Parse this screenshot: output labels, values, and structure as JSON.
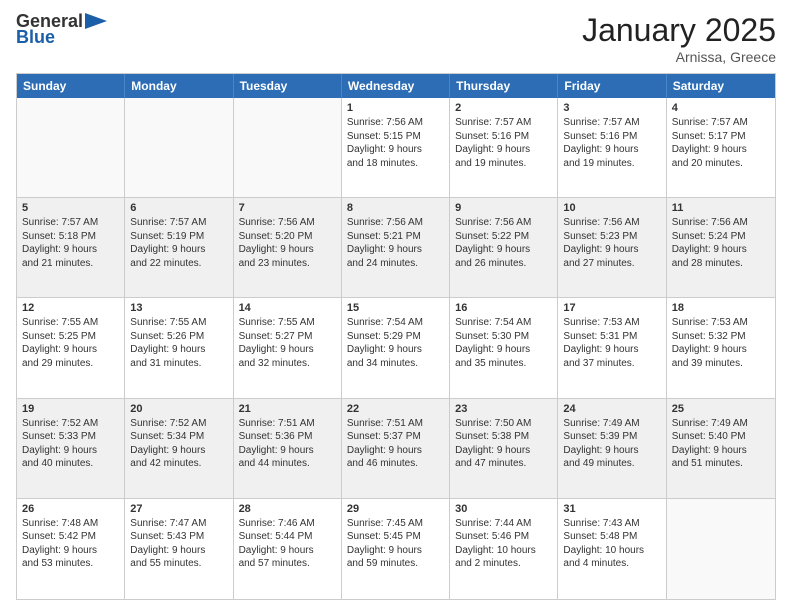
{
  "header": {
    "logo_general": "General",
    "logo_blue": "Blue",
    "month": "January 2025",
    "location": "Arnissa, Greece"
  },
  "weekdays": [
    "Sunday",
    "Monday",
    "Tuesday",
    "Wednesday",
    "Thursday",
    "Friday",
    "Saturday"
  ],
  "rows": [
    [
      {
        "day": "",
        "empty": true,
        "lines": []
      },
      {
        "day": "",
        "empty": true,
        "lines": []
      },
      {
        "day": "",
        "empty": true,
        "lines": []
      },
      {
        "day": "1",
        "lines": [
          "Sunrise: 7:56 AM",
          "Sunset: 5:15 PM",
          "Daylight: 9 hours",
          "and 18 minutes."
        ]
      },
      {
        "day": "2",
        "lines": [
          "Sunrise: 7:57 AM",
          "Sunset: 5:16 PM",
          "Daylight: 9 hours",
          "and 19 minutes."
        ]
      },
      {
        "day": "3",
        "lines": [
          "Sunrise: 7:57 AM",
          "Sunset: 5:16 PM",
          "Daylight: 9 hours",
          "and 19 minutes."
        ]
      },
      {
        "day": "4",
        "lines": [
          "Sunrise: 7:57 AM",
          "Sunset: 5:17 PM",
          "Daylight: 9 hours",
          "and 20 minutes."
        ]
      }
    ],
    [
      {
        "day": "5",
        "shaded": true,
        "lines": [
          "Sunrise: 7:57 AM",
          "Sunset: 5:18 PM",
          "Daylight: 9 hours",
          "and 21 minutes."
        ]
      },
      {
        "day": "6",
        "shaded": true,
        "lines": [
          "Sunrise: 7:57 AM",
          "Sunset: 5:19 PM",
          "Daylight: 9 hours",
          "and 22 minutes."
        ]
      },
      {
        "day": "7",
        "shaded": true,
        "lines": [
          "Sunrise: 7:56 AM",
          "Sunset: 5:20 PM",
          "Daylight: 9 hours",
          "and 23 minutes."
        ]
      },
      {
        "day": "8",
        "shaded": true,
        "lines": [
          "Sunrise: 7:56 AM",
          "Sunset: 5:21 PM",
          "Daylight: 9 hours",
          "and 24 minutes."
        ]
      },
      {
        "day": "9",
        "shaded": true,
        "lines": [
          "Sunrise: 7:56 AM",
          "Sunset: 5:22 PM",
          "Daylight: 9 hours",
          "and 26 minutes."
        ]
      },
      {
        "day": "10",
        "shaded": true,
        "lines": [
          "Sunrise: 7:56 AM",
          "Sunset: 5:23 PM",
          "Daylight: 9 hours",
          "and 27 minutes."
        ]
      },
      {
        "day": "11",
        "shaded": true,
        "lines": [
          "Sunrise: 7:56 AM",
          "Sunset: 5:24 PM",
          "Daylight: 9 hours",
          "and 28 minutes."
        ]
      }
    ],
    [
      {
        "day": "12",
        "lines": [
          "Sunrise: 7:55 AM",
          "Sunset: 5:25 PM",
          "Daylight: 9 hours",
          "and 29 minutes."
        ]
      },
      {
        "day": "13",
        "lines": [
          "Sunrise: 7:55 AM",
          "Sunset: 5:26 PM",
          "Daylight: 9 hours",
          "and 31 minutes."
        ]
      },
      {
        "day": "14",
        "lines": [
          "Sunrise: 7:55 AM",
          "Sunset: 5:27 PM",
          "Daylight: 9 hours",
          "and 32 minutes."
        ]
      },
      {
        "day": "15",
        "lines": [
          "Sunrise: 7:54 AM",
          "Sunset: 5:29 PM",
          "Daylight: 9 hours",
          "and 34 minutes."
        ]
      },
      {
        "day": "16",
        "lines": [
          "Sunrise: 7:54 AM",
          "Sunset: 5:30 PM",
          "Daylight: 9 hours",
          "and 35 minutes."
        ]
      },
      {
        "day": "17",
        "lines": [
          "Sunrise: 7:53 AM",
          "Sunset: 5:31 PM",
          "Daylight: 9 hours",
          "and 37 minutes."
        ]
      },
      {
        "day": "18",
        "lines": [
          "Sunrise: 7:53 AM",
          "Sunset: 5:32 PM",
          "Daylight: 9 hours",
          "and 39 minutes."
        ]
      }
    ],
    [
      {
        "day": "19",
        "shaded": true,
        "lines": [
          "Sunrise: 7:52 AM",
          "Sunset: 5:33 PM",
          "Daylight: 9 hours",
          "and 40 minutes."
        ]
      },
      {
        "day": "20",
        "shaded": true,
        "lines": [
          "Sunrise: 7:52 AM",
          "Sunset: 5:34 PM",
          "Daylight: 9 hours",
          "and 42 minutes."
        ]
      },
      {
        "day": "21",
        "shaded": true,
        "lines": [
          "Sunrise: 7:51 AM",
          "Sunset: 5:36 PM",
          "Daylight: 9 hours",
          "and 44 minutes."
        ]
      },
      {
        "day": "22",
        "shaded": true,
        "lines": [
          "Sunrise: 7:51 AM",
          "Sunset: 5:37 PM",
          "Daylight: 9 hours",
          "and 46 minutes."
        ]
      },
      {
        "day": "23",
        "shaded": true,
        "lines": [
          "Sunrise: 7:50 AM",
          "Sunset: 5:38 PM",
          "Daylight: 9 hours",
          "and 47 minutes."
        ]
      },
      {
        "day": "24",
        "shaded": true,
        "lines": [
          "Sunrise: 7:49 AM",
          "Sunset: 5:39 PM",
          "Daylight: 9 hours",
          "and 49 minutes."
        ]
      },
      {
        "day": "25",
        "shaded": true,
        "lines": [
          "Sunrise: 7:49 AM",
          "Sunset: 5:40 PM",
          "Daylight: 9 hours",
          "and 51 minutes."
        ]
      }
    ],
    [
      {
        "day": "26",
        "lines": [
          "Sunrise: 7:48 AM",
          "Sunset: 5:42 PM",
          "Daylight: 9 hours",
          "and 53 minutes."
        ]
      },
      {
        "day": "27",
        "lines": [
          "Sunrise: 7:47 AM",
          "Sunset: 5:43 PM",
          "Daylight: 9 hours",
          "and 55 minutes."
        ]
      },
      {
        "day": "28",
        "lines": [
          "Sunrise: 7:46 AM",
          "Sunset: 5:44 PM",
          "Daylight: 9 hours",
          "and 57 minutes."
        ]
      },
      {
        "day": "29",
        "lines": [
          "Sunrise: 7:45 AM",
          "Sunset: 5:45 PM",
          "Daylight: 9 hours",
          "and 59 minutes."
        ]
      },
      {
        "day": "30",
        "lines": [
          "Sunrise: 7:44 AM",
          "Sunset: 5:46 PM",
          "Daylight: 10 hours",
          "and 2 minutes."
        ]
      },
      {
        "day": "31",
        "lines": [
          "Sunrise: 7:43 AM",
          "Sunset: 5:48 PM",
          "Daylight: 10 hours",
          "and 4 minutes."
        ]
      },
      {
        "day": "",
        "empty": true,
        "lines": []
      }
    ]
  ]
}
